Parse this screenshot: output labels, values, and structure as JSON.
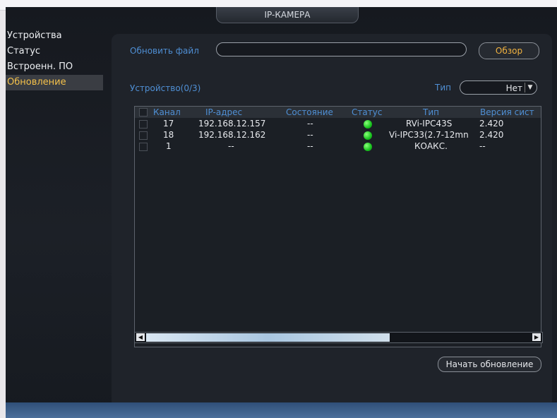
{
  "window": {
    "title": "IP-КАМЕРА"
  },
  "sidebar": {
    "items": [
      {
        "label": "Устройства"
      },
      {
        "label": "Статус"
      },
      {
        "label": "Встроенн. ПО"
      },
      {
        "label": "Обновление"
      }
    ]
  },
  "update_file": {
    "label": "Обновить файл",
    "value": "",
    "browse_label": "Обзор"
  },
  "devices": {
    "label": "Устройство(0/3)"
  },
  "type_filter": {
    "label": "Тип",
    "value": "Нет"
  },
  "table": {
    "headers": [
      "Канал",
      "IP-адрес",
      "Состояние",
      "Статус",
      "Тип",
      "Версия сист"
    ],
    "rows": [
      {
        "channel": "17",
        "ip": "192.168.12.157",
        "state": "--",
        "type": "RVi-IPC43S",
        "version": "2.420"
      },
      {
        "channel": "18",
        "ip": "192.168.12.162",
        "state": "--",
        "type": "Vi-IPC33(2.7-12mn",
        "version": "2.420"
      },
      {
        "channel": "1",
        "ip": "--",
        "state": "--",
        "type": "КОАКС.",
        "version": "--"
      }
    ]
  },
  "actions": {
    "start_update": "Начать обновление"
  },
  "colors": {
    "status_online": "#22c41e",
    "accent": "#f2b340",
    "label_blue": "#4f8fd4"
  }
}
